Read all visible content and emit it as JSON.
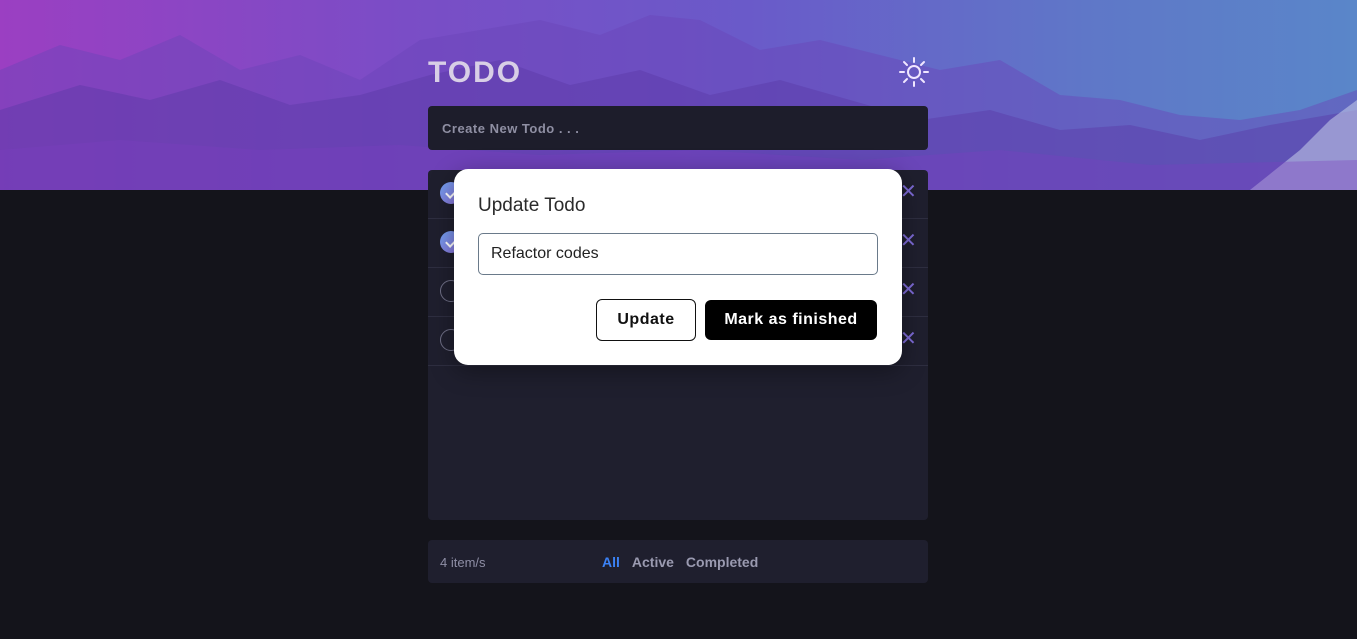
{
  "header": {
    "title": "TODO",
    "theme_icon": "sun-icon"
  },
  "new_todo": {
    "placeholder": "Create New Todo . . ."
  },
  "todos": [
    {
      "completed": true
    },
    {
      "completed": true
    },
    {
      "completed": false
    },
    {
      "completed": false
    }
  ],
  "footer": {
    "count": "4 item/s",
    "filters": [
      "All",
      "Active",
      "Completed"
    ],
    "active_filter": "All"
  },
  "modal": {
    "title": "Update Todo",
    "input_value": "Refactor codes",
    "update_label": "Update",
    "finish_label": "Mark as finished"
  },
  "colors": {
    "accent": "#3b82f6",
    "banner_start": "#9b3fc2",
    "banner_end": "#5a86c9",
    "background": "#14141b",
    "panel": "#1f1f2e"
  }
}
